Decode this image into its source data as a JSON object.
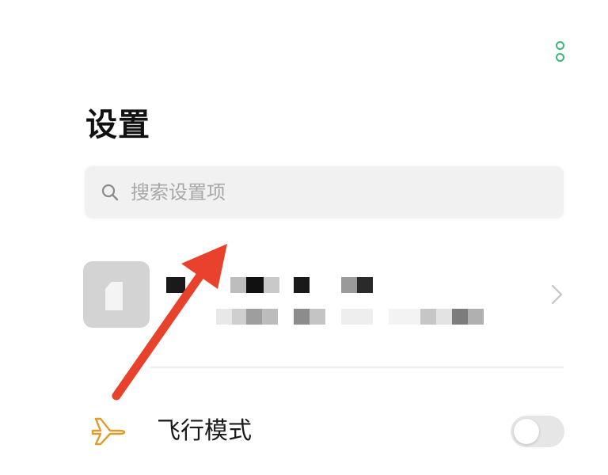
{
  "header": {
    "title": "设置",
    "more_icon": "more-vertical-icon",
    "accent_color": "#3fb47a"
  },
  "search": {
    "icon": "search-icon",
    "placeholder": "搜索设置项",
    "value": ""
  },
  "account": {
    "avatar_icon": "sim-card-icon",
    "chevron_icon": "chevron-right-icon"
  },
  "settings_items": [
    {
      "label": "飞行模式",
      "icon": "airplane-icon",
      "icon_color": "#e39b2d",
      "toggle_on": false
    }
  ],
  "annotation": {
    "arrow_color": "#e8412c"
  }
}
